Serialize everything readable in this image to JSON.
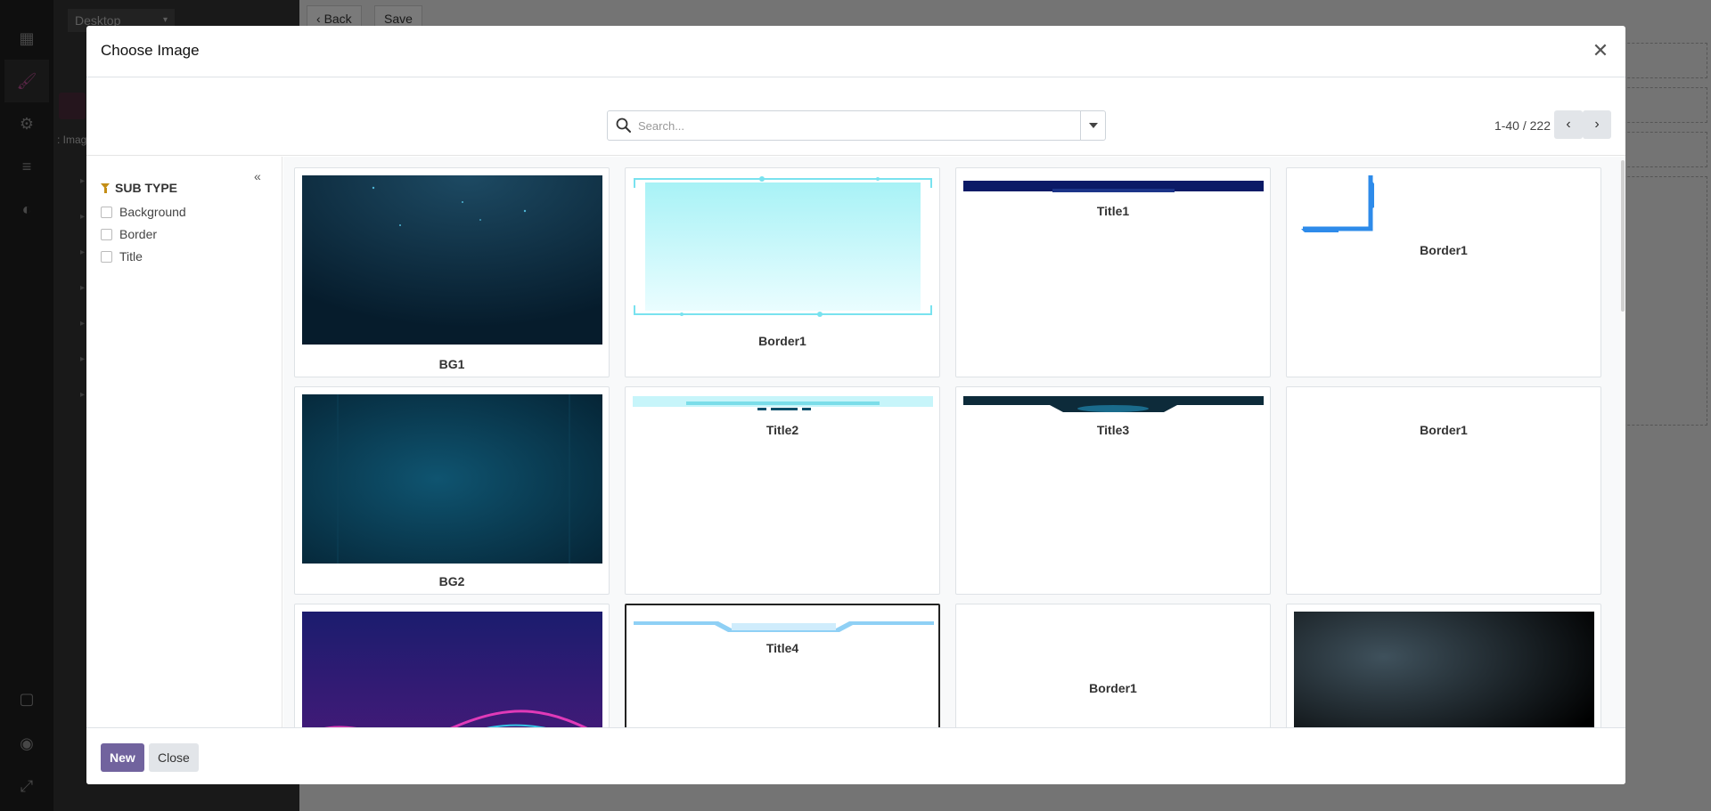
{
  "background": {
    "device_select": "Desktop",
    "back_label": "Back",
    "save_label": "Save",
    "image_label": ": Imag"
  },
  "modal": {
    "title": "Choose Image",
    "search_placeholder": "Search...",
    "pager": "1-40 / 222",
    "filter": {
      "title": "SUB TYPE",
      "options": [
        "Background",
        "Border",
        "Title"
      ]
    },
    "cards": [
      {
        "caption": "BG1",
        "icon": "dark-navy-background-thumbnail"
      },
      {
        "caption": "Border1",
        "icon": "cyan-tech-frame-thumbnail"
      },
      {
        "caption": "Title1",
        "icon": "navy-title-bar-thumbnail"
      },
      {
        "caption": "Border1",
        "icon": "blue-corner-border-thumbnail"
      },
      {
        "caption": "BG2",
        "icon": "teal-radial-background-thumbnail"
      },
      {
        "caption": "Title2",
        "icon": "light-cyan-title-bar-thumbnail"
      },
      {
        "caption": "Title3",
        "icon": "dark-teal-title-bar-thumbnail"
      },
      {
        "caption": "Border1",
        "icon": "blank-border-thumbnail"
      },
      {
        "caption": "",
        "icon": "purple-wave-background-thumbnail"
      },
      {
        "caption": "Title4",
        "icon": "light-blue-title-bar-thumbnail"
      },
      {
        "caption": "Border1",
        "icon": "blank-border-thumbnail"
      },
      {
        "caption": "",
        "icon": "black-gradient-background-thumbnail"
      }
    ],
    "new_label": "New",
    "close_label": "Close"
  },
  "colors": {
    "primary": "#71639e",
    "filter_icon": "#c48e16"
  }
}
